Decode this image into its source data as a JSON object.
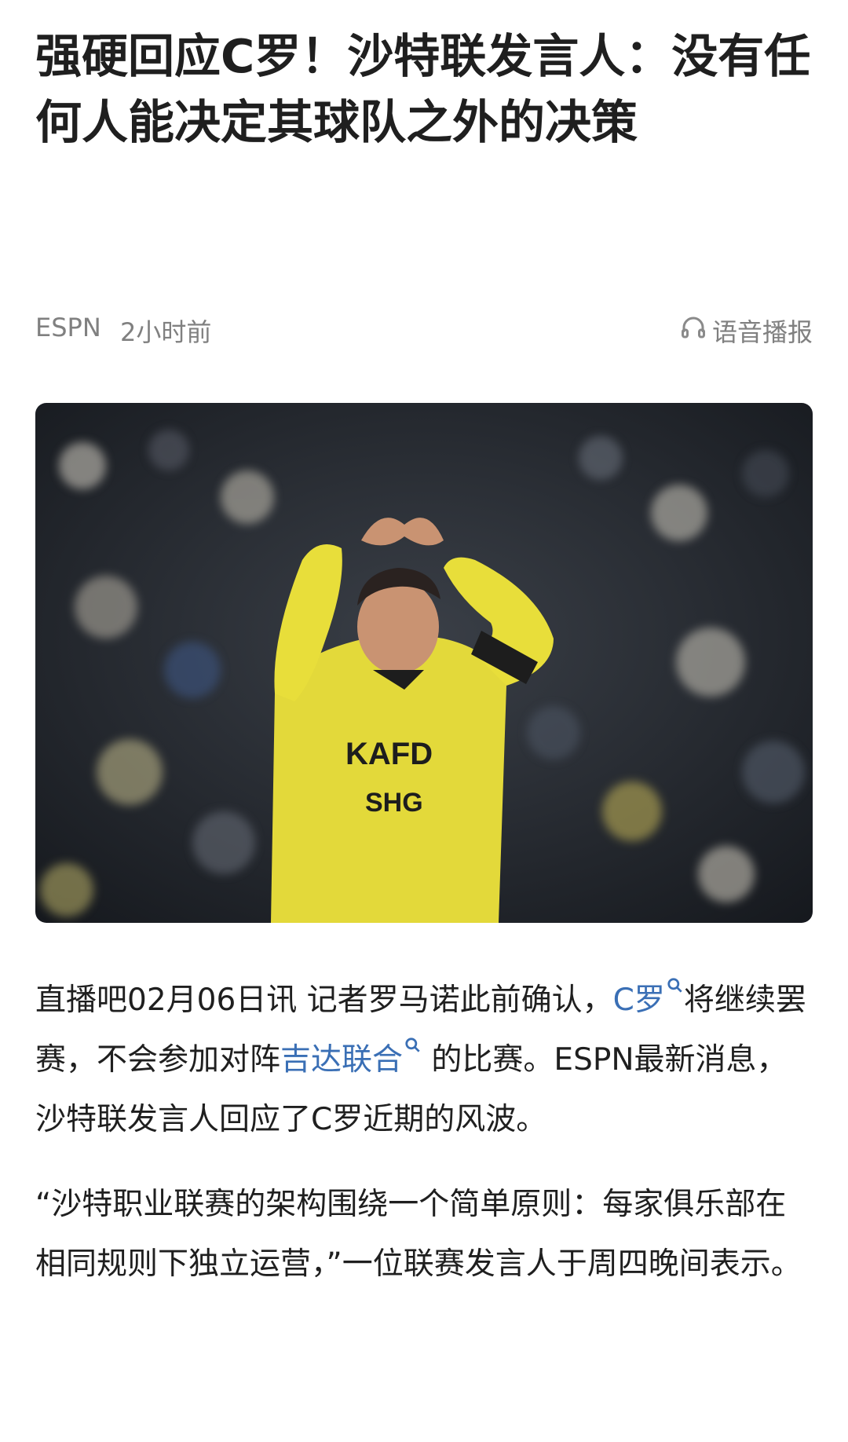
{
  "article": {
    "title": "强硬回应C罗！沙特联发言人：没有任何人能决定其球队之外的决策",
    "source": "ESPN",
    "time": "2小时前",
    "audio_label": "语音播报",
    "hero_image_alt": "",
    "paragraph1": {
      "part1": "直播吧02月06日讯 记者罗马诺此前确认，",
      "link1": "C罗",
      "part2": "将继续罢赛，不会参加对阵",
      "link2": "吉达联合",
      "part3": " 的比赛。ESPN最新消息，沙特联发言人回应了C罗近期的风波。"
    },
    "paragraph2": "“沙特职业联赛的架构围绕一个简单原则：每家俱乐部在相同规则下独立运营，”一位联赛发言人于周四晚间表示。",
    "jersey_text": {
      "sponsor": "KAFD",
      "sponsor2": "SHG"
    }
  },
  "colors": {
    "link": "#3a6fb5",
    "meta": "#808080",
    "jersey": "#e8de3a"
  }
}
